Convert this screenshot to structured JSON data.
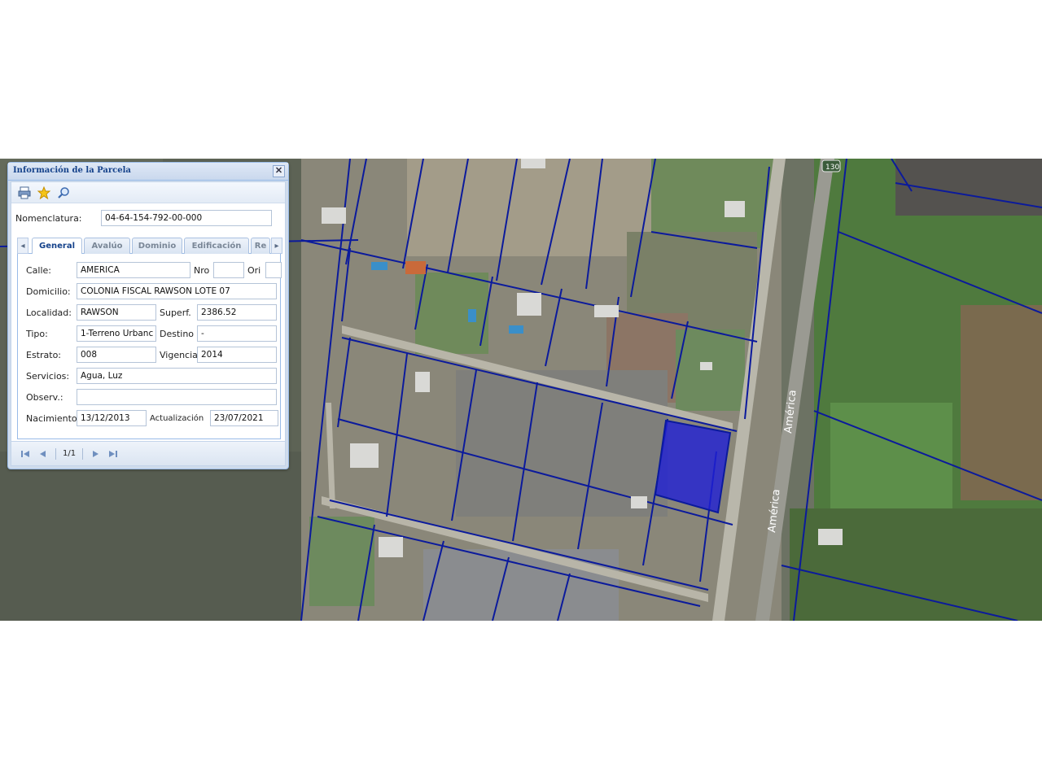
{
  "window": {
    "title": "Información de la Parcela",
    "close_icon": "close-icon"
  },
  "toolbar": {
    "icons": [
      "print-icon",
      "star-icon",
      "zoom-icon"
    ]
  },
  "nomenclatura": {
    "label": "Nomenclatura:",
    "value": "04-64-154-792-00-000"
  },
  "tabs": [
    {
      "label": "General",
      "active": true
    },
    {
      "label": "Avalúo",
      "active": false
    },
    {
      "label": "Dominio",
      "active": false
    },
    {
      "label": "Edificación",
      "active": false
    },
    {
      "label": "Re",
      "active": false
    }
  ],
  "general": {
    "calle_label": "Calle:",
    "calle_value": "AMERICA",
    "nro_label": "Nro",
    "nro_value": "",
    "ori_label": "Ori",
    "ori_value": "",
    "domicilio_label": "Domicilio:",
    "domicilio_value": "COLONIA FISCAL RAWSON LOTE 07",
    "localidad_label": "Localidad:",
    "localidad_value": "RAWSON",
    "superf_label": "Superf.",
    "superf_value": "2386.52",
    "tipo_label": "Tipo:",
    "tipo_value": "1-Terreno Urbanc",
    "destino_label": "Destino",
    "destino_value": "-",
    "estrato_label": "Estrato:",
    "estrato_value": "008",
    "vigencia_label": "Vigencia",
    "vigencia_value": "2014",
    "servicios_label": "Servicios:",
    "servicios_value": "Agua, Luz",
    "observ_label": "Observ.:",
    "observ_value": "",
    "nacimiento_label": "Nacimiento:",
    "nacimiento_value": "13/12/2013",
    "actualizacion_label": "Actualización",
    "actualizacion_value": "23/07/2021"
  },
  "pager": {
    "count": "1/1"
  },
  "map": {
    "road_label_main": "América",
    "road_label_secondary": "América",
    "route_badge": "130",
    "parcel_line_color": "#0b1a9c",
    "selected_parcel_color": "#1f1fd6"
  }
}
